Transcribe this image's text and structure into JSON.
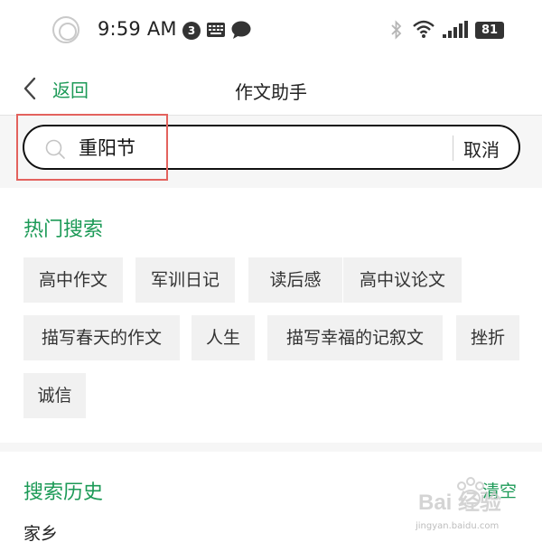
{
  "status_bar": {
    "time": "9:59 AM",
    "notification_count": "3",
    "battery": "81",
    "icons": [
      "circle-icon",
      "keyboard-icon",
      "chat-icon",
      "bluetooth-icon",
      "wifi-icon",
      "signal-icon",
      "battery-icon"
    ]
  },
  "nav": {
    "back_label": "返回",
    "title": "作文助手"
  },
  "search": {
    "value": "重阳节",
    "cancel_label": "取消"
  },
  "hot_search": {
    "title": "热门搜索",
    "tags": [
      "高中作文",
      "军训日记",
      "读后感",
      "高中议论文",
      "描写春天的作文",
      "人生",
      "描写幸福的记叙文",
      "挫折",
      "诚信"
    ]
  },
  "history": {
    "title": "搜索历史",
    "clear_label": "清空",
    "items": [
      "家乡"
    ]
  },
  "watermark": {
    "brand": "Bai 经验",
    "url": "jingyan.baidu.com"
  },
  "colors": {
    "accent_green": "#1c9a57",
    "highlight_red": "#e3625d",
    "tag_bg": "#f1f1f1",
    "section_bg": "#f6f6f6"
  }
}
